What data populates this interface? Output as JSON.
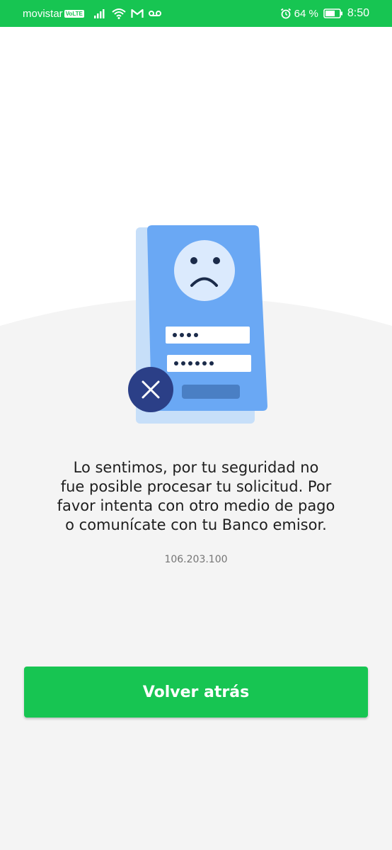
{
  "status_bar": {
    "carrier": "movistar",
    "volte_badge": "VoLTE",
    "battery_percent": "64 %",
    "time": "8:50",
    "left_icons": [
      "signal-icon",
      "wifi-icon",
      "gmail-icon",
      "voicemail-icon"
    ],
    "right_icons": [
      "alarm-icon",
      "battery-icon"
    ]
  },
  "main": {
    "illustration": {
      "icons": [
        "sad-face-icon",
        "close-icon"
      ],
      "password_fields": [
        "••••",
        "••••••"
      ]
    },
    "message": "Lo sentimos, por tu seguridad no fue posible procesar tu solicitud. Por favor intenta con otro medio de pago o comunícate con tu Banco emisor.",
    "message_lines": [
      "Lo sentimos, por tu seguridad no",
      "fue posible procesar tu solicitud. Por",
      "favor intenta con otro medio de pago",
      "o comunícate con tu Banco emisor."
    ],
    "error_code": "106.203.100",
    "back_button_label": "Volver atrás"
  },
  "colors": {
    "primary": "#17c552",
    "background_curve": "#f4f4f4",
    "text": "#1e1e1e",
    "muted_text": "#757575",
    "illustration_card": "#6aa8f4",
    "illustration_card_back": "#c7dff9",
    "badge_dark": "#2b3f87"
  }
}
